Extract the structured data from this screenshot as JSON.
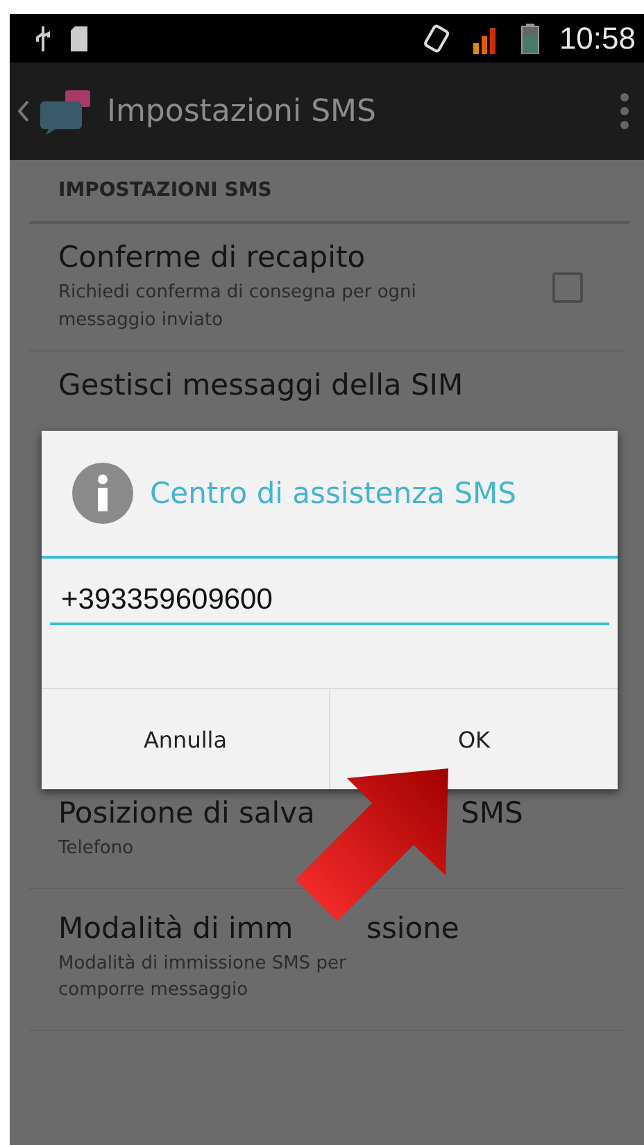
{
  "status_bar": {
    "time": "10:58"
  },
  "action_bar": {
    "title": "Impostazioni SMS"
  },
  "settings": {
    "header": "IMPOSTAZIONI SMS",
    "items": [
      {
        "kind": "checkbox",
        "title": "Conferme di recapito",
        "subtitle": "Richiedi conferma di consegna per ogni messaggio inviato",
        "checked": false
      },
      {
        "kind": "plain",
        "title": "Gestisci messaggi della SIM"
      }
    ]
  },
  "lower_items": [
    {
      "title_start": "Posizione di salva",
      "title_end": "SMS",
      "subtitle": "Telefono"
    },
    {
      "title_start": "Modalità di imm",
      "title_end": "ssione",
      "subtitle": "Modalità di immissione SMS per comporre messaggio"
    }
  ],
  "dialog": {
    "title": "Centro di assistenza SMS",
    "value": "+393359609600",
    "buttons": [
      "Annulla",
      "OK"
    ]
  }
}
